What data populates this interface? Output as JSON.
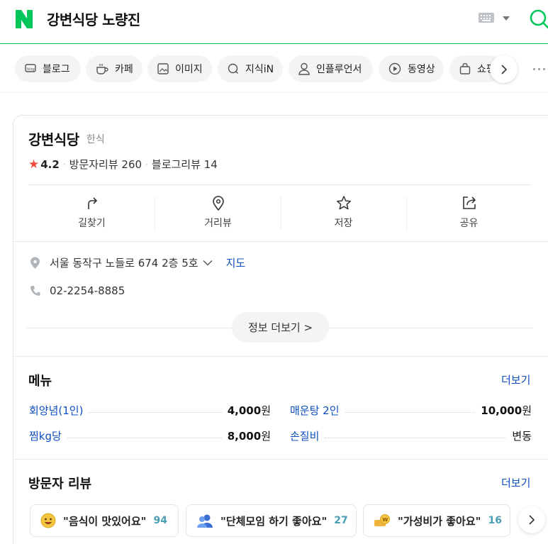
{
  "header": {
    "search_query": "강변식당 노량진",
    "accent_color": "#03c75a"
  },
  "tabs": [
    {
      "label": "블로그",
      "icon": "blog-icon"
    },
    {
      "label": "카페",
      "icon": "cafe-cup-icon"
    },
    {
      "label": "이미지",
      "icon": "image-icon"
    },
    {
      "label": "지식iN",
      "icon": "question-icon"
    },
    {
      "label": "인플루언서",
      "icon": "person-icon"
    },
    {
      "label": "동영상",
      "icon": "play-icon"
    },
    {
      "label": "쇼핑",
      "icon": "shopping-bag-icon"
    }
  ],
  "place": {
    "name": "강변식당",
    "category": "한식",
    "rating": "4.2",
    "visitor_reviews": "방문자리뷰 260",
    "blog_reviews": "블로그리뷰 14",
    "rating_color": "#f14a3c"
  },
  "actions": [
    {
      "label": "길찾기",
      "icon": "directions-icon"
    },
    {
      "label": "거리뷰",
      "icon": "location-pin-icon"
    },
    {
      "label": "저장",
      "icon": "star-outline-icon"
    },
    {
      "label": "공유",
      "icon": "share-icon"
    }
  ],
  "info": {
    "address": "서울 동작구 노들로 674 2층 5호",
    "map_link": "지도",
    "phone": "02-2254-8885",
    "more_button": "정보 더보기 >"
  },
  "menu": {
    "title": "메뉴",
    "more": "더보기",
    "items": [
      {
        "name": "회양념(1인)",
        "price": "4,000",
        "unit": "원"
      },
      {
        "name": "매운탕 2인",
        "price": "10,000",
        "unit": "원"
      },
      {
        "name": "찜kg당",
        "price": "8,000",
        "unit": "원"
      },
      {
        "name": "손질비",
        "price": "",
        "unit": "변동"
      }
    ]
  },
  "reviews": {
    "title": "방문자 리뷰",
    "more": "더보기",
    "chips": [
      {
        "text": "\"음식이 맛있어요\"",
        "count": "94",
        "icon": "yummy-face-icon"
      },
      {
        "text": "\"단체모임 하기 좋아요\"",
        "count": "27",
        "icon": "people-icon"
      },
      {
        "text": "\"가성비가 좋아요\"",
        "count": "16",
        "icon": "money-icon"
      }
    ]
  }
}
